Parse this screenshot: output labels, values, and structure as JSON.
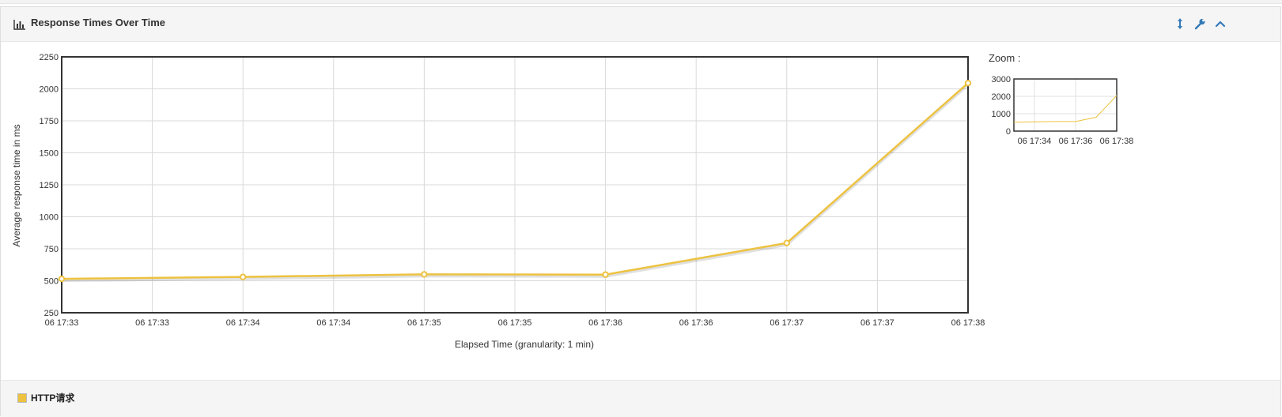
{
  "panel": {
    "title": "Response Times Over Time",
    "icons": {
      "header": "bar-chart-icon",
      "resize": "vertical-resize-icon",
      "settings": "wrench-icon",
      "collapse": "chevron-up-icon"
    }
  },
  "zoom": {
    "label": "Zoom :"
  },
  "legend": {
    "label": "HTTP请求"
  },
  "colors": {
    "series": "#edc240",
    "grid": "#d9d9d9",
    "axis": "#333333"
  },
  "chart_data": {
    "type": "line",
    "xlabel": "Elapsed Time (granularity: 1 min)",
    "ylabel": "Average response time in ms",
    "ylim": [
      250,
      2250
    ],
    "yticks": [
      250,
      500,
      750,
      1000,
      1250,
      1500,
      1750,
      2000,
      2250
    ],
    "xticks": [
      "06 17:33",
      "06 17:33",
      "06 17:34",
      "06 17:34",
      "06 17:35",
      "06 17:35",
      "06 17:36",
      "06 17:36",
      "06 17:37",
      "06 17:37",
      "06 17:38"
    ],
    "grid": true,
    "series": [
      {
        "name": "HTTP请求",
        "x_minutes": [
          0,
          1,
          2,
          3,
          4,
          5
        ],
        "values": [
          515,
          530,
          550,
          548,
          795,
          2045
        ]
      }
    ],
    "overview": {
      "ylim": [
        0,
        3000
      ],
      "yticks": [
        0,
        1000,
        2000,
        3000
      ],
      "xticks": [
        "06 17:34",
        "06 17:36",
        "06 17:38"
      ]
    }
  }
}
